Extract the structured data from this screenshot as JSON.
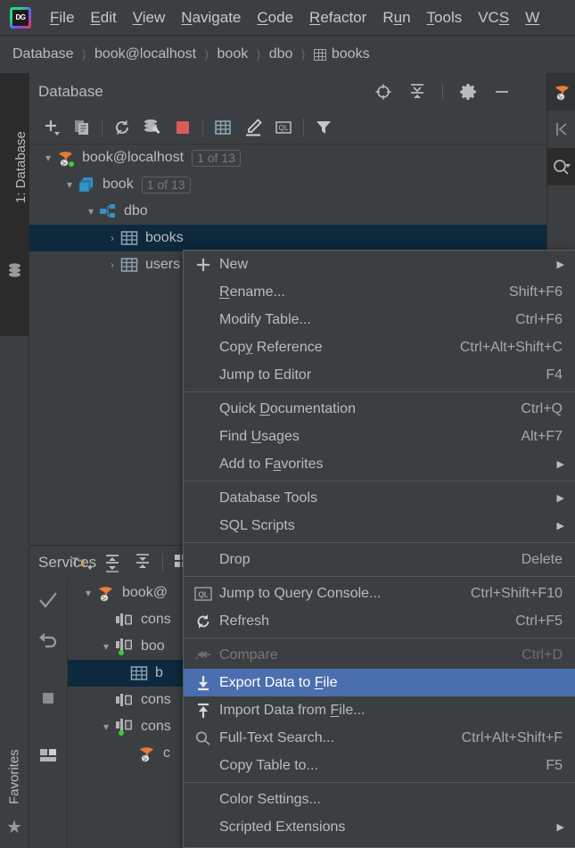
{
  "app": {
    "logo_text": "DG"
  },
  "menubar": {
    "items": [
      {
        "label": "File",
        "mnemonic": "F"
      },
      {
        "label": "Edit",
        "mnemonic": "E"
      },
      {
        "label": "View",
        "mnemonic": "V"
      },
      {
        "label": "Navigate",
        "mnemonic": "N"
      },
      {
        "label": "Code",
        "mnemonic": "C"
      },
      {
        "label": "Refactor",
        "mnemonic": "R"
      },
      {
        "label": "Run",
        "mnemonic": "u"
      },
      {
        "label": "Tools",
        "mnemonic": "T"
      },
      {
        "label": "VCS",
        "mnemonic": "S"
      },
      {
        "label": "W",
        "mnemonic": "W"
      }
    ]
  },
  "breadcrumb": {
    "separator": "〉",
    "items": [
      "Database",
      "book@localhost",
      "book",
      "dbo",
      "books"
    ],
    "last_icon": "table-icon"
  },
  "left_rail": {
    "database_tab": "1: Database",
    "database_icon": "database-stack-icon",
    "favorites_tab": "Favorites",
    "favorites_icon": "star-icon"
  },
  "database_panel": {
    "title": "Database",
    "header_actions": [
      {
        "name": "locate-icon",
        "glyph": "target"
      },
      {
        "name": "collapse-all-icon",
        "glyph": "collapse"
      },
      {
        "name": "settings-gear-icon",
        "glyph": "gear"
      },
      {
        "name": "hide-icon",
        "glyph": "minus"
      }
    ],
    "toolbar": [
      {
        "name": "add-new-button",
        "glyph": "plus-dropdown"
      },
      {
        "name": "duplicate-button",
        "glyph": "copy"
      },
      {
        "name": "refresh-button",
        "glyph": "refresh"
      },
      {
        "name": "data-source-properties-button",
        "glyph": "db-wrench"
      },
      {
        "name": "stop-button",
        "glyph": "stop-red"
      },
      {
        "name": "open-table-editor-button",
        "glyph": "table"
      },
      {
        "name": "modify-button",
        "glyph": "pencil"
      },
      {
        "name": "query-console-button",
        "glyph": "ql"
      },
      {
        "name": "filter-button",
        "glyph": "funnel"
      }
    ],
    "tree": [
      {
        "indent": 0,
        "twisty": "⌄",
        "icon": "datasource-icon",
        "label": "book@localhost",
        "badge": "1 of 13",
        "selected": false
      },
      {
        "indent": 1,
        "twisty": "⌄",
        "icon": "database-icon",
        "label": "book",
        "badge": "1 of 13",
        "selected": false
      },
      {
        "indent": 2,
        "twisty": "⌄",
        "icon": "schema-icon",
        "label": "dbo",
        "badge": "",
        "selected": false
      },
      {
        "indent": 3,
        "twisty": "›",
        "icon": "table-icon",
        "label": "books",
        "badge": "",
        "selected": true
      },
      {
        "indent": 3,
        "twisty": "›",
        "icon": "table-icon",
        "label": "users",
        "badge": "",
        "selected": false
      }
    ]
  },
  "services_panel": {
    "title": "Services",
    "vertical_toolbar": [
      {
        "name": "commit-button",
        "glyph": "check"
      },
      {
        "name": "rollback-button",
        "glyph": "undo"
      },
      {
        "name": "stop-button",
        "glyph": "stop-square"
      },
      {
        "name": "layout-button",
        "glyph": "layout"
      }
    ],
    "toolbar": [
      {
        "name": "transaction-mode-button",
        "glyph": "Tx"
      },
      {
        "name": "expand-all-button",
        "glyph": "expand"
      },
      {
        "name": "collapse-all-button",
        "glyph": "collapse"
      },
      {
        "name": "view-options-button",
        "glyph": "grid-dropdown"
      }
    ],
    "tree": [
      {
        "indent": 0,
        "twisty": "⌄",
        "icon": "datasource-icon",
        "label": "book@",
        "selected": false
      },
      {
        "indent": 1,
        "twisty": "",
        "icon": "console-icon",
        "label": "cons",
        "selected": false
      },
      {
        "indent": 1,
        "twisty": "⌄",
        "icon": "console-icon-active",
        "label": "boo",
        "selected": false
      },
      {
        "indent": 2,
        "twisty": "",
        "icon": "table-icon",
        "label": "b",
        "selected": true
      },
      {
        "indent": 1,
        "twisty": "",
        "icon": "console-icon",
        "label": "cons",
        "selected": false
      },
      {
        "indent": 1,
        "twisty": "⌄",
        "icon": "console-icon-active",
        "label": "cons",
        "selected": false
      },
      {
        "indent": 2,
        "twisty": "",
        "icon": "datasource-icon",
        "label": "c",
        "selected": false
      }
    ]
  },
  "right_rail": {
    "buttons": [
      {
        "name": "database-tool-icon",
        "glyph": "datasource"
      },
      {
        "name": "collapse-panel-icon",
        "glyph": "bar-chevron-left"
      },
      {
        "name": "search-everywhere-icon",
        "glyph": "search-dropdown"
      }
    ]
  },
  "context_menu": {
    "items": [
      {
        "icon": "plus-icon",
        "label": "New",
        "mnemonic": "",
        "shortcut": "",
        "submenu": true,
        "highlight": false,
        "disabled": false
      },
      {
        "icon": "",
        "label": "Rename...",
        "mnemonic": "R",
        "shortcut": "Shift+F6",
        "submenu": false,
        "highlight": false,
        "disabled": false
      },
      {
        "icon": "",
        "label": "Modify Table...",
        "mnemonic": "",
        "shortcut": "Ctrl+F6",
        "submenu": false,
        "highlight": false,
        "disabled": false
      },
      {
        "icon": "",
        "label": "Copy Reference",
        "mnemonic": "y",
        "shortcut": "Ctrl+Alt+Shift+C",
        "submenu": false,
        "highlight": false,
        "disabled": false
      },
      {
        "icon": "",
        "label": "Jump to Editor",
        "mnemonic": "",
        "shortcut": "F4",
        "submenu": false,
        "highlight": false,
        "disabled": false
      },
      {
        "separator": true
      },
      {
        "icon": "",
        "label": "Quick Documentation",
        "mnemonic": "D",
        "shortcut": "Ctrl+Q",
        "submenu": false,
        "highlight": false,
        "disabled": false
      },
      {
        "icon": "",
        "label": "Find Usages",
        "mnemonic": "U",
        "shortcut": "Alt+F7",
        "submenu": false,
        "highlight": false,
        "disabled": false
      },
      {
        "icon": "",
        "label": "Add to Favorites",
        "mnemonic": "a",
        "shortcut": "",
        "submenu": true,
        "highlight": false,
        "disabled": false
      },
      {
        "separator": true
      },
      {
        "icon": "",
        "label": "Database Tools",
        "mnemonic": "",
        "shortcut": "",
        "submenu": true,
        "highlight": false,
        "disabled": false
      },
      {
        "icon": "",
        "label": "SQL Scripts",
        "mnemonic": "",
        "shortcut": "",
        "submenu": true,
        "highlight": false,
        "disabled": false
      },
      {
        "separator": true
      },
      {
        "icon": "",
        "label": "Drop",
        "mnemonic": "",
        "shortcut": "Delete",
        "submenu": false,
        "highlight": false,
        "disabled": false
      },
      {
        "separator": true
      },
      {
        "icon": "ql-icon",
        "label": "Jump to Query Console...",
        "mnemonic": "",
        "shortcut": "Ctrl+Shift+F10",
        "submenu": false,
        "highlight": false,
        "disabled": false
      },
      {
        "icon": "refresh-icon",
        "label": "Refresh",
        "mnemonic": "",
        "shortcut": "Ctrl+F5",
        "submenu": false,
        "highlight": false,
        "disabled": false
      },
      {
        "separator": true
      },
      {
        "icon": "compare-icon",
        "label": "Compare",
        "mnemonic": "",
        "shortcut": "Ctrl+D",
        "submenu": false,
        "highlight": false,
        "disabled": true
      },
      {
        "icon": "export-icon",
        "label": "Export Data to File",
        "mnemonic": "F",
        "shortcut": "",
        "submenu": false,
        "highlight": true,
        "disabled": false
      },
      {
        "icon": "import-icon",
        "label": "Import Data from File...",
        "mnemonic": "F",
        "shortcut": "",
        "submenu": false,
        "highlight": false,
        "disabled": false
      },
      {
        "icon": "search-icon",
        "label": "Full-Text Search...",
        "mnemonic": "",
        "shortcut": "Ctrl+Alt+Shift+F",
        "submenu": false,
        "highlight": false,
        "disabled": false
      },
      {
        "icon": "",
        "label": "Copy Table to...",
        "mnemonic": "",
        "shortcut": "F5",
        "submenu": false,
        "highlight": false,
        "disabled": false
      },
      {
        "separator": true
      },
      {
        "icon": "",
        "label": "Color Settings...",
        "mnemonic": "",
        "shortcut": "",
        "submenu": false,
        "highlight": false,
        "disabled": false
      },
      {
        "icon": "",
        "label": "Scripted Extensions",
        "mnemonic": "",
        "shortcut": "",
        "submenu": true,
        "highlight": false,
        "disabled": false
      }
    ]
  },
  "colors": {
    "background": "#3c3f41",
    "dark_background": "#2b2b2b",
    "selection_blue": "#4b6eaf",
    "tree_selection": "#0d293e",
    "text": "#bbbbbb",
    "accent_red": "#db5c5c",
    "table_icon": "#8a9ba8",
    "db_icon": "#3592c4",
    "green_dot": "#3ec93e"
  }
}
